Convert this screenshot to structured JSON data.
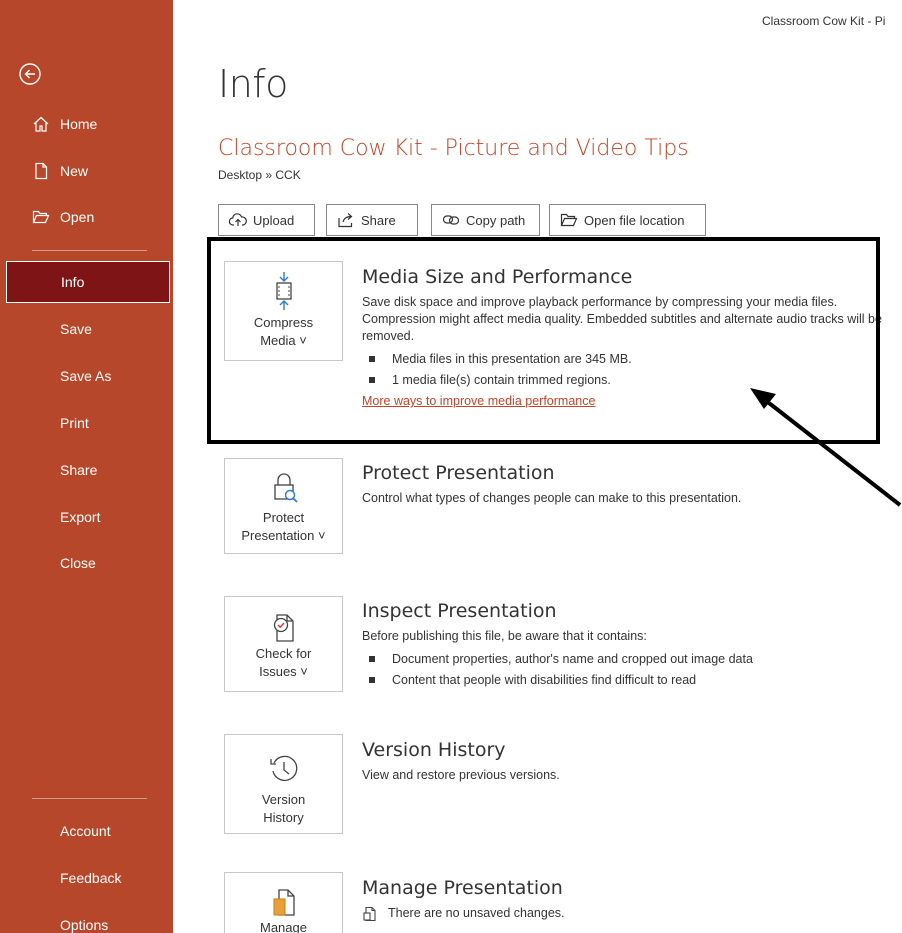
{
  "window": {
    "title": "Classroom Cow Kit - Pi"
  },
  "sidebar": {
    "top_items": [
      {
        "label": "Home",
        "icon": "home-icon"
      },
      {
        "label": "New",
        "icon": "new-file-icon"
      },
      {
        "label": "Open",
        "icon": "folder-open-icon"
      }
    ],
    "items": [
      "Info",
      "Save",
      "Save As",
      "Print",
      "Share",
      "Export",
      "Close"
    ],
    "active": "Info",
    "bottom_items": [
      "Account",
      "Feedback",
      "Options"
    ]
  },
  "page": {
    "title": "Info",
    "doc_title": "Classroom Cow Kit - Picture and Video Tips",
    "doc_path": "Desktop » CCK"
  },
  "actions": {
    "upload": "Upload",
    "share": "Share",
    "copy_path": "Copy path",
    "open_location": "Open file location"
  },
  "sections": {
    "media": {
      "button_line1": "Compress",
      "button_line2": "Media ˅",
      "heading": "Media Size and Performance",
      "desc": "Save disk space and improve playback performance by compressing your media files. Compression might affect media quality. Embedded subtitles and alternate audio tracks will be removed.",
      "bullets": [
        "Media files in this presentation are 345 MB.",
        "1 media file(s) contain trimmed regions."
      ],
      "link": "More ways to improve media performance"
    },
    "protect": {
      "button_line1": "Protect",
      "button_line2": "Presentation ˅",
      "heading": "Protect Presentation",
      "desc": "Control what types of changes people can make to this presentation."
    },
    "inspect": {
      "button_line1": "Check for",
      "button_line2": "Issues ˅",
      "heading": "Inspect Presentation",
      "desc": "Before publishing this file, be aware that it contains:",
      "bullets": [
        "Document properties, author's name and cropped out image data",
        "Content that people with disabilities find difficult to read"
      ]
    },
    "version": {
      "button_line1": "Version",
      "button_line2": "History",
      "heading": "Version History",
      "desc": "View and restore previous versions."
    },
    "manage": {
      "button_line1": "Manage",
      "heading": "Manage Presentation",
      "desc": "There are no unsaved changes."
    }
  },
  "colors": {
    "sidebar_bg": "#b7472a",
    "sidebar_active": "#7f1417",
    "accent_text": "#c0462a"
  }
}
